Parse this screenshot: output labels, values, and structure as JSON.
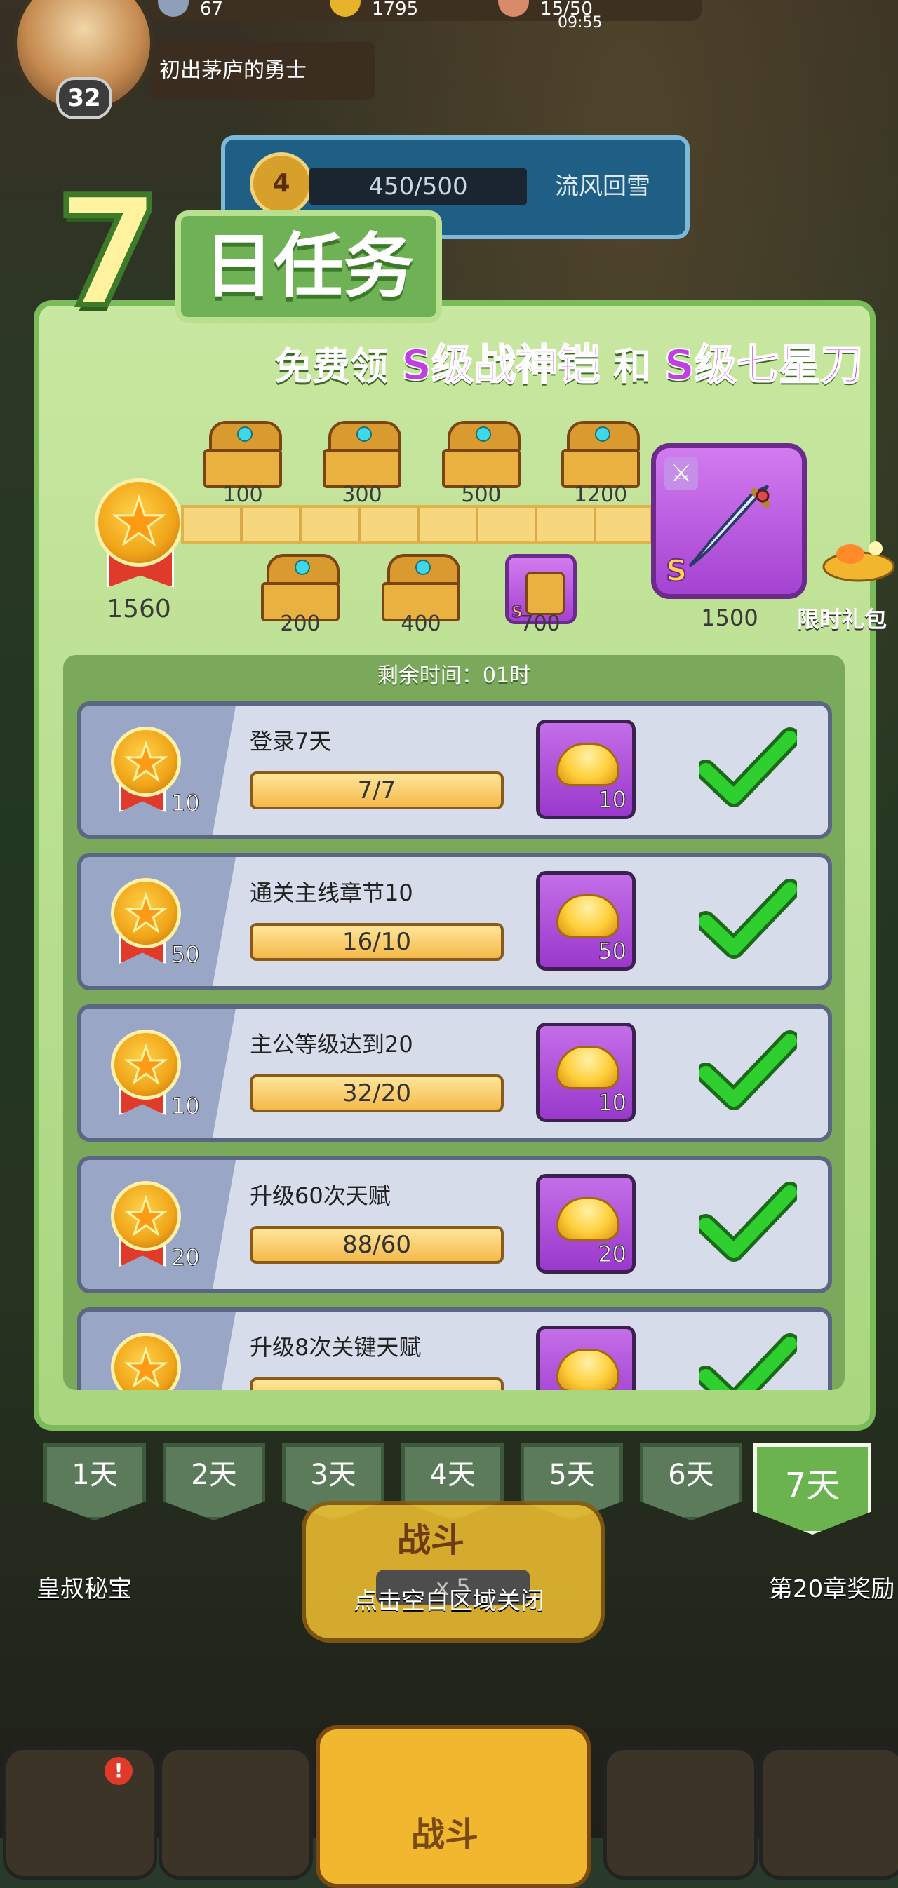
{
  "hud": {
    "stamina": "67",
    "gold": "1795",
    "energy": "15/50",
    "energy_timer": "09:55",
    "level": "32",
    "title": "初出茅庐的勇士"
  },
  "stage": {
    "medal": "4",
    "progress": "450/500",
    "name": "流风回雪"
  },
  "panel": {
    "title_number": "7",
    "title_text": "日任务",
    "subtitle_pre": "免费领",
    "subtitle_item1": "S级战神铠",
    "subtitle_mid": "和",
    "subtitle_item2": "S级七星刀",
    "points": "1560",
    "milestones_top": [
      "100",
      "300",
      "500",
      "1200"
    ],
    "milestones_bottom": [
      "200",
      "400",
      "700"
    ],
    "final_reward": "1500",
    "grade": "S",
    "gift_label": "限时礼包",
    "timer": "剩余时间：01时"
  },
  "tasks": [
    {
      "name": "登录7天",
      "progress": "7/7",
      "points": "10",
      "reward": "10"
    },
    {
      "name": "通关主线章节10",
      "progress": "16/10",
      "points": "50",
      "reward": "50"
    },
    {
      "name": "主公等级达到20",
      "progress": "32/20",
      "points": "10",
      "reward": "10"
    },
    {
      "name": "升级60次天赋",
      "progress": "88/60",
      "points": "20",
      "reward": "20"
    },
    {
      "name": "升级8次关键天赋",
      "progress": "",
      "points": "",
      "reward": ""
    }
  ],
  "days": [
    "1天",
    "2天",
    "3天",
    "4天",
    "5天",
    "6天",
    "7天"
  ],
  "footer": {
    "close_hint": "点击空白区域关闭",
    "left_label": "皇叔秘宝",
    "right_label": "第20章奖励",
    "battle_label": "战斗",
    "battle_cost": "x 5",
    "bottom_battle": "战斗",
    "badge": "!"
  },
  "colors": {
    "panel_green": "#a9d67f",
    "accent_purple": "#c13ee0",
    "check_green": "#2ecf2e"
  }
}
